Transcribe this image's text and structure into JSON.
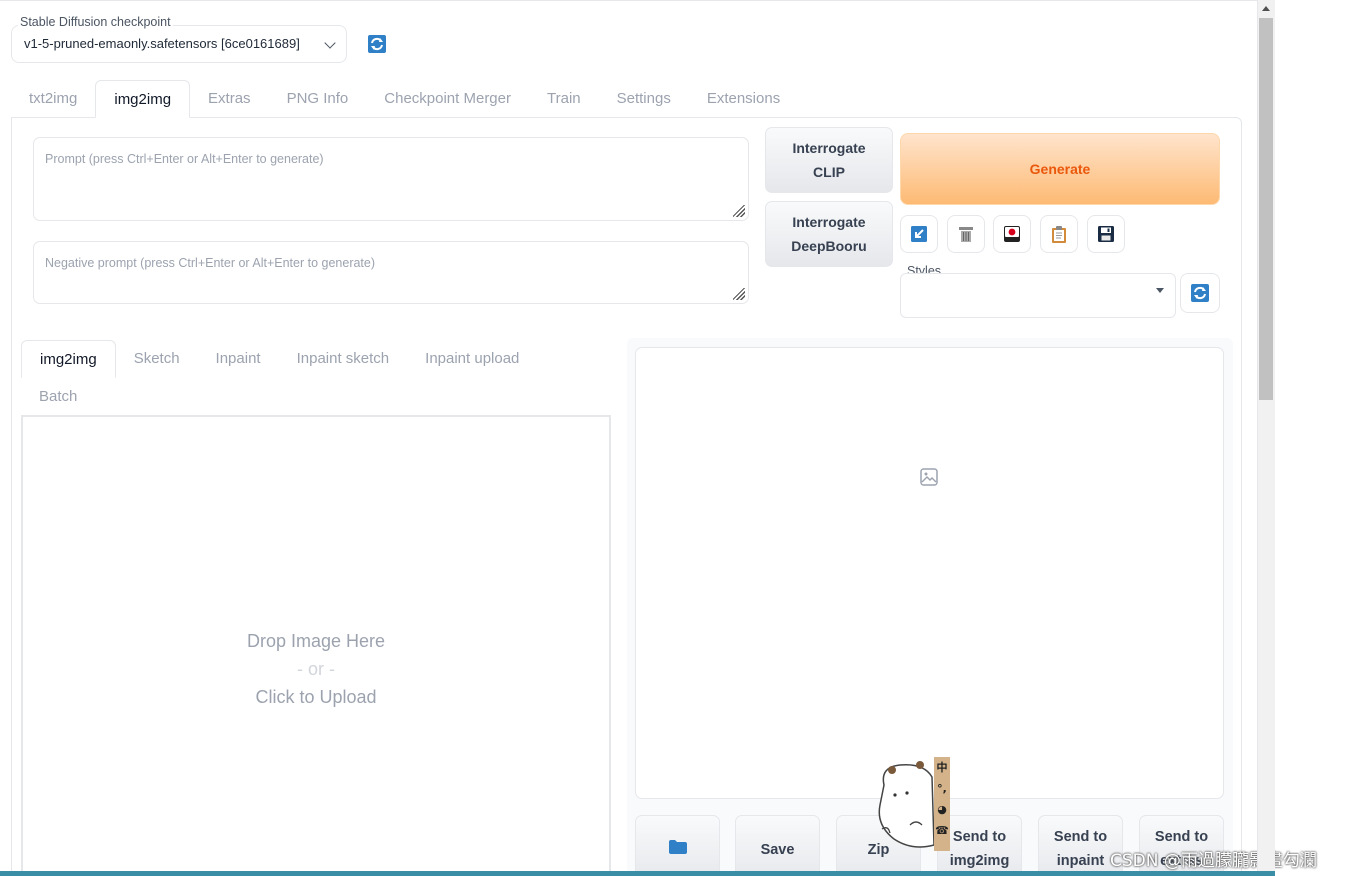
{
  "checkpoint": {
    "label": "Stable Diffusion checkpoint",
    "value": "v1-5-pruned-emaonly.safetensors [6ce0161689]"
  },
  "main_tabs": [
    "txt2img",
    "img2img",
    "Extras",
    "PNG Info",
    "Checkpoint Merger",
    "Train",
    "Settings",
    "Extensions"
  ],
  "active_main_tab": "img2img",
  "prompt": {
    "placeholder": "Prompt (press Ctrl+Enter or Alt+Enter to generate)"
  },
  "negative_prompt": {
    "placeholder": "Negative prompt (press Ctrl+Enter or Alt+Enter to generate)"
  },
  "interrogate": {
    "clip_line1": "Interrogate",
    "clip_line2": "CLIP",
    "deepbooru_line1": "Interrogate",
    "deepbooru_line2": "DeepBooru"
  },
  "generate_label": "Generate",
  "styles_label": "Styles",
  "sub_tabs": [
    "img2img",
    "Sketch",
    "Inpaint",
    "Inpaint sketch",
    "Inpaint upload",
    "Batch"
  ],
  "upload": {
    "line1": "Drop Image Here",
    "line2": "- or -",
    "line3": "Click to Upload"
  },
  "output_buttons": {
    "save": "Save",
    "zip": "Zip",
    "img2img_l1": "Send to",
    "img2img_l2": "img2img",
    "inpaint_l1": "Send to",
    "inpaint_l2": "inpaint",
    "extras_l1": "Send to",
    "extras_l2": "extras"
  },
  "mascot_chars": [
    "中",
    "°,",
    "◕",
    "☎"
  ],
  "watermark": "CSDN @雨過朦朧影畫勾瀾",
  "colors": {
    "accent": "#ea580c",
    "generate_bg": "#fdba74",
    "icon_blue": "#1e6bb8"
  }
}
